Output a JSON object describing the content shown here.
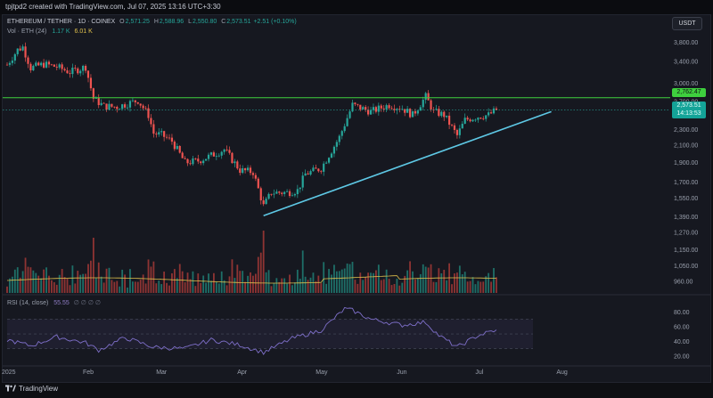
{
  "window": {
    "credit": "tpjtpd2 created with TradingView.com, Jul 07, 2025 13:16 UTC+3:30"
  },
  "header": {
    "symbol": "ETHEREUM / TETHER · 1D · COINEX",
    "open_label": "O",
    "open": "2,571.25",
    "high_label": "H",
    "high": "2,588.96",
    "low_label": "L",
    "low": "2,550.80",
    "close_label": "C",
    "close": "2,573.51",
    "change": "+2.51 (+0.10%)"
  },
  "volume_legend": {
    "label": "Vol · ETH (24)",
    "value": "1.17 K",
    "ma_value": "6.01 K"
  },
  "rsi_legend": {
    "label": "RSI (14, close)",
    "value": "55.55",
    "na": "∅ ∅ ∅ ∅"
  },
  "currency_button": "USDT",
  "badges": {
    "level": "2,762.47",
    "price": "2,573.51",
    "countdown": "14:13:53"
  },
  "footer": {
    "brand": "TradingView"
  },
  "colors": {
    "up": "#26a69a",
    "down": "#ef5350",
    "level_line": "#3ecf3e",
    "trendline": "#5ec8e5",
    "rsi": "#7e6fc9",
    "volume_ma": "#e0c14c"
  },
  "icons": [
    "tradingview-logo-icon"
  ],
  "chart_data": [
    {
      "type": "candlestick",
      "title": "ETHEREUM / TETHER · 1D · COINEX",
      "y_scale": "log",
      "y_ticks": [
        960,
        1050,
        1150,
        1270,
        1390,
        1550,
        1700,
        1900,
        2100,
        2300,
        2500,
        2700,
        3000,
        3400,
        3800
      ],
      "y_tick_labels": [
        "960.00",
        "1,050.00",
        "1,150.00",
        "1,270.00",
        "1,390.00",
        "1,550.00",
        "1,700.00",
        "1,900.00",
        "2,100.00",
        "2,300.00",
        "2,500.00",
        "2,700.00",
        "3,000.00",
        "3,400.00",
        "3,800.00"
      ],
      "x_ticks": [
        "2025",
        "Feb",
        "Mar",
        "Apr",
        "May",
        "Jun",
        "Jul",
        "Aug"
      ],
      "date_range": [
        "2025-01-01",
        "2025-07-07"
      ],
      "series": [
        {
          "name": "ETH/USDT",
          "points": [
            [
              "2025-01-01",
              3340
            ],
            [
              "2025-01-05",
              3640
            ],
            [
              "2025-01-07",
              3700
            ],
            [
              "2025-01-10",
              3280
            ],
            [
              "2025-01-15",
              3350
            ],
            [
              "2025-01-20",
              3300
            ],
            [
              "2025-01-25",
              3200
            ],
            [
              "2025-01-31",
              3300
            ],
            [
              "2025-02-03",
              2750
            ],
            [
              "2025-02-07",
              2630
            ],
            [
              "2025-02-12",
              2620
            ],
            [
              "2025-02-20",
              2720
            ],
            [
              "2025-02-24",
              2500
            ],
            [
              "2025-02-26",
              2250
            ],
            [
              "2025-03-01",
              2230
            ],
            [
              "2025-03-05",
              2150
            ],
            [
              "2025-03-10",
              1900
            ],
            [
              "2025-03-15",
              1920
            ],
            [
              "2025-03-20",
              1980
            ],
            [
              "2025-03-25",
              2050
            ],
            [
              "2025-03-31",
              1820
            ],
            [
              "2025-04-05",
              1800
            ],
            [
              "2025-04-09",
              1480
            ],
            [
              "2025-04-12",
              1600
            ],
            [
              "2025-04-18",
              1600
            ],
            [
              "2025-04-22",
              1620
            ],
            [
              "2025-04-25",
              1780
            ],
            [
              "2025-05-01",
              1840
            ],
            [
              "2025-05-08",
              2200
            ],
            [
              "2025-05-13",
              2650
            ],
            [
              "2025-05-20",
              2550
            ],
            [
              "2025-05-27",
              2650
            ],
            [
              "2025-06-01",
              2600
            ],
            [
              "2025-06-05",
              2500
            ],
            [
              "2025-06-10",
              2780
            ],
            [
              "2025-06-13",
              2550
            ],
            [
              "2025-06-17",
              2500
            ],
            [
              "2025-06-22",
              2220
            ],
            [
              "2025-06-25",
              2430
            ],
            [
              "2025-06-30",
              2480
            ],
            [
              "2025-07-04",
              2500
            ],
            [
              "2025-07-07",
              2573.51
            ]
          ]
        }
      ],
      "horizontal_line": {
        "value": 2762.47
      },
      "trendline": [
        [
          "2025-04-09",
          1400
        ],
        [
          "2025-07-28",
          2550
        ]
      ]
    },
    {
      "type": "bar",
      "title": "Vol · ETH (24)",
      "series": [
        {
          "name": "Volume",
          "last_value": "1.17 K"
        },
        {
          "name": "Volume MA",
          "last_value": "6.01 K"
        }
      ]
    },
    {
      "type": "line",
      "title": "RSI (14, close)",
      "y_ticks": [
        20,
        40,
        60,
        80
      ],
      "y_tick_labels": [
        "20.00",
        "40.00",
        "60.00",
        "80.00"
      ],
      "bands": [
        30,
        70
      ],
      "series": [
        {
          "name": "RSI",
          "points": [
            [
              "2025-01-01",
              42
            ],
            [
              "2025-01-10",
              34
            ],
            [
              "2025-01-20",
              46
            ],
            [
              "2025-01-31",
              38
            ],
            [
              "2025-02-05",
              28
            ],
            [
              "2025-02-15",
              45
            ],
            [
              "2025-02-26",
              32
            ],
            [
              "2025-03-10",
              30
            ],
            [
              "2025-03-20",
              42
            ],
            [
              "2025-03-31",
              35
            ],
            [
              "2025-04-09",
              25
            ],
            [
              "2025-04-20",
              44
            ],
            [
              "2025-05-01",
              55
            ],
            [
              "2025-05-10",
              84
            ],
            [
              "2025-05-13",
              82
            ],
            [
              "2025-05-20",
              70
            ],
            [
              "2025-06-01",
              62
            ],
            [
              "2025-06-10",
              66
            ],
            [
              "2025-06-15",
              48
            ],
            [
              "2025-06-22",
              32
            ],
            [
              "2025-06-30",
              48
            ],
            [
              "2025-07-07",
              55.55
            ]
          ]
        }
      ]
    }
  ]
}
